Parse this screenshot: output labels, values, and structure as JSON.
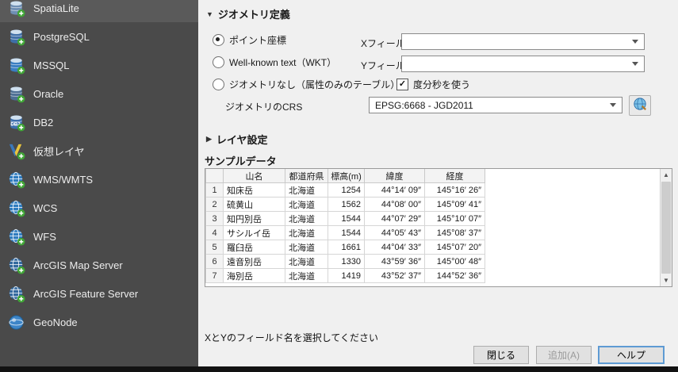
{
  "sidebar": {
    "items": [
      {
        "label": "SpatiaLite",
        "icon": "spatialite-database-icon",
        "kind": "db",
        "color": "#6f8fb4"
      },
      {
        "label": "PostgreSQL",
        "icon": "postgresql-database-icon",
        "kind": "db",
        "color": "#3f6fa8"
      },
      {
        "label": "MSSQL",
        "icon": "mssql-database-icon",
        "kind": "db",
        "color": "#3a7ec2"
      },
      {
        "label": "Oracle",
        "icon": "oracle-database-icon",
        "kind": "db",
        "color": "#4d6f94"
      },
      {
        "label": "DB2",
        "icon": "db2-database-icon",
        "kind": "db2",
        "color": "#3c6fae"
      },
      {
        "label": "仮想レイヤ",
        "icon": "virtual-layer-icon",
        "kind": "virtual",
        "color": "#3b78bb"
      },
      {
        "label": "WMS/WMTS",
        "icon": "wms-wmts-globe-icon",
        "kind": "globe",
        "color": "#2f7cbf"
      },
      {
        "label": "WCS",
        "icon": "wcs-globe-icon",
        "kind": "globe",
        "color": "#2f7cbf"
      },
      {
        "label": "WFS",
        "icon": "wfs-globe-icon",
        "kind": "globe",
        "color": "#2f7cbf"
      },
      {
        "label": "ArcGIS Map Server",
        "icon": "arcgis-map-server-icon",
        "kind": "globe",
        "color": "#33699e"
      },
      {
        "label": "ArcGIS Feature Server",
        "icon": "arcgis-feature-server-icon",
        "kind": "globe",
        "color": "#33699e"
      },
      {
        "label": "GeoNode",
        "icon": "geonode-icon",
        "kind": "sphere",
        "color": "#3d85c8"
      }
    ]
  },
  "main": {
    "geometry": {
      "title": "ジオメトリ定義",
      "options": [
        {
          "label": "ポイント座標",
          "selected": true
        },
        {
          "label": "Well-known text（WKT）",
          "selected": false
        },
        {
          "label": "ジオメトリなし（属性のみのテーブル）",
          "selected": false
        }
      ],
      "x_field": {
        "label": "Xフィールド",
        "value": ""
      },
      "y_field": {
        "label": "Yフィールド",
        "value": ""
      },
      "dms": {
        "label": "度分秒を使う",
        "checked": true
      },
      "crs": {
        "label": "ジオメトリのCRS",
        "value": "EPSG:6668 - JGD2011"
      }
    },
    "layer_settings_title": "レイヤ設定",
    "sample_title": "サンプルデータ",
    "table": {
      "columns": [
        "山名",
        "都道府県",
        "標高(m)",
        "緯度",
        "経度"
      ],
      "rows": [
        [
          "1",
          "知床岳",
          "北海道",
          "1254",
          "44°14′ 09″",
          "145°16′ 26″"
        ],
        [
          "2",
          "硫黄山",
          "北海道",
          "1562",
          "44°08′ 00″",
          "145°09′ 41″"
        ],
        [
          "3",
          "知円別岳",
          "北海道",
          "1544",
          "44°07′ 29″",
          "145°10′ 07″"
        ],
        [
          "4",
          "サシルイ岳",
          "北海道",
          "1544",
          "44°05′ 43″",
          "145°08′ 37″"
        ],
        [
          "5",
          "羅臼岳",
          "北海道",
          "1661",
          "44°04′ 33″",
          "145°07′ 20″"
        ],
        [
          "6",
          "遠音別岳",
          "北海道",
          "1330",
          "43°59′ 36″",
          "145°00′ 48″"
        ],
        [
          "7",
          "海別岳",
          "北海道",
          "1419",
          "43°52′ 37″",
          "144°52′ 36″"
        ]
      ]
    },
    "status": "XとYのフィールド名を選択してください",
    "buttons": {
      "close": "閉じる",
      "add": "追加(A)",
      "help": "ヘルプ"
    }
  },
  "colors": {
    "accent": "#0078d7",
    "sidebar_bg": "#4a4a4a",
    "plus_badge": "#3fa535"
  }
}
